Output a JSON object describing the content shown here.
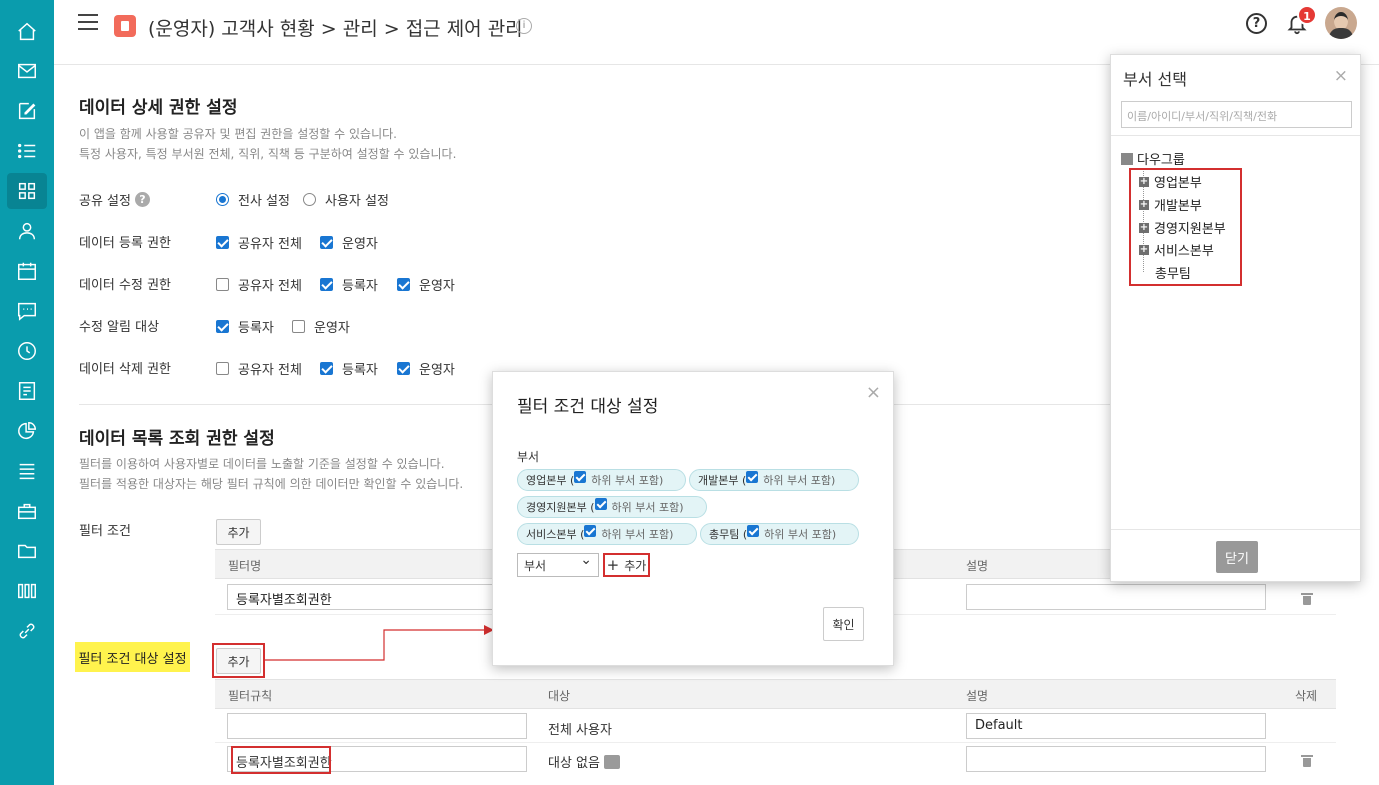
{
  "header": {
    "title": "(운영자) 고객사 현황 > 관리 > 접근 제어 관리",
    "info": "i",
    "help": "?",
    "notification_count": "1"
  },
  "sidebar": {
    "items": [
      "home-icon",
      "mail-icon",
      "edit-icon",
      "list-icon",
      "grid-icon",
      "user-icon",
      "calendar-icon",
      "chat-icon",
      "clock-icon",
      "report-icon",
      "chart-icon",
      "board-icon",
      "briefcase-icon",
      "folder-icon",
      "apps-icon",
      "link-icon"
    ],
    "active": "grid-icon"
  },
  "detail": {
    "title": "데이터 상세 권한 설정",
    "desc1": "이 앱을 함께 사용할 공유자 및 편집 권한을 설정할 수 있습니다.",
    "desc2": "특정 사용자, 특정 부서원 전체, 직위, 직책 등 구분하여 설정할 수 있습니다.",
    "share_label": "공유 설정",
    "share_help": "?",
    "share_opt1": "전사 설정",
    "share_opt2": "사용자 설정",
    "reg_label": "데이터 등록 권한",
    "reg_opt1": "공유자 전체",
    "reg_opt2": "운영자",
    "edit_label": "데이터 수정 권한",
    "edit_opt1": "공유자 전체",
    "edit_opt2": "등록자",
    "edit_opt3": "운영자",
    "notify_label": "수정 알림 대상",
    "notify_opt1": "등록자",
    "notify_opt2": "운영자",
    "del_label": "데이터 삭제 권한",
    "del_opt1": "공유자 전체",
    "del_opt2": "등록자",
    "del_opt3": "운영자"
  },
  "list": {
    "title": "데이터 목록 조회 권한 설정",
    "desc1": "필터를 이용하여 사용자별로 데이터를 노출할 기준을 설정할 수 있습니다.",
    "desc2": "필터를 적용한 대상자는 해당 필터 규칙에 의한 데이터만 확인할 수 있습니다.",
    "filter_label": "필터 조건",
    "add": "추가",
    "col_name": "필터명",
    "col_desc": "설명",
    "filter_row_name": "등록자별조회권한",
    "target_label": "필터 조건 대상 설정",
    "col_rule": "필터규칙",
    "col_target": "대상",
    "col_delete": "삭제",
    "row1_target": "전체 사용자",
    "row1_desc": "Default",
    "row2_rule": "등록자별조회권한",
    "row2_target": "대상 없음"
  },
  "modal": {
    "title": "필터 조건 대상 설정",
    "close": "×",
    "dept_label": "부서",
    "chips": [
      {
        "name": "영업본부",
        "sub": "하위 부서 포함)"
      },
      {
        "name": "개발본부",
        "sub": "하위 부서 포함)"
      },
      {
        "name": "경영지원본부",
        "sub": "하위 부서 포함)"
      },
      {
        "name": "서비스본부",
        "sub": "하위 부서 포함)"
      },
      {
        "name": "총무팀",
        "sub": "하위 부서 포함)"
      }
    ],
    "select_value": "부서",
    "add": "추가",
    "ok": "확인"
  },
  "panel": {
    "title": "부서 선택",
    "close": "×",
    "search_placeholder": "이름/아이디/부서/직위/직책/전화",
    "root": "다우그룹",
    "items": [
      "영업본부",
      "개발본부",
      "경영지원본부",
      "서비스본부",
      "총무팀"
    ],
    "close_button": "닫기"
  },
  "colors": {
    "sidebar": "#0a9cad",
    "accent": "#1976d2",
    "highlight": "#fff34d",
    "annotation": "#d32f2f"
  }
}
